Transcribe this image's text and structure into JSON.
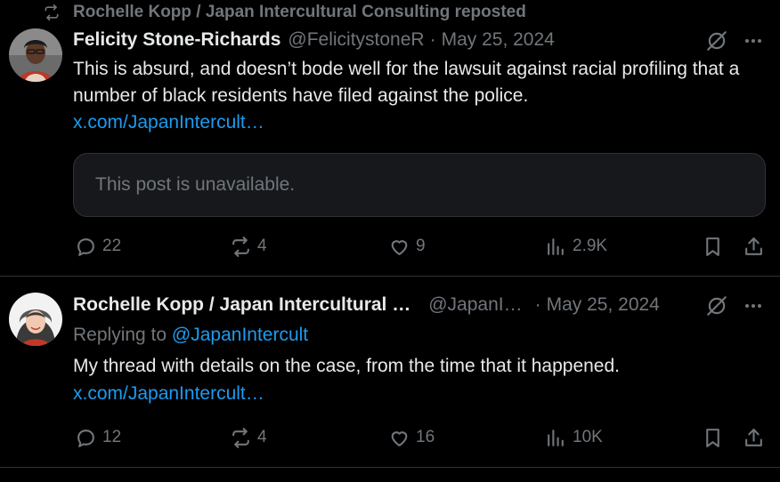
{
  "posts": [
    {
      "repost_by": "Rochelle Kopp / Japan Intercultural Consulting reposted",
      "author_name": "Felicity Stone-Richards",
      "handle": "@FelicitystoneR",
      "separator": "·",
      "date": "May 25, 2024",
      "text": "This is absurd, and doesn’t bode well for the lawsuit against racial profiling that a number of black residents have filed against the police.",
      "link": "x.com/JapanIntercult…",
      "quote_text": "This post is unavailable.",
      "stats": {
        "replies": "22",
        "reposts": "4",
        "likes": "9",
        "views": "2.9K"
      }
    },
    {
      "author_name": "Rochelle Kopp / Japan Intercultural …",
      "handle": "@JapanI…",
      "separator": "·",
      "date": "May 25, 2024",
      "replying_prefix": "Replying to",
      "replying_to": "@JapanIntercult",
      "text": "My thread with details on the case, from the time that it happened.",
      "link": "x.com/JapanIntercult…",
      "stats": {
        "replies": "12",
        "reposts": "4",
        "likes": "16",
        "views": "10K"
      }
    }
  ],
  "colors": {
    "background": "#000000",
    "text": "#e7e9ea",
    "muted": "#71767b",
    "link": "#1d9bf0",
    "divider": "#2f3336"
  }
}
